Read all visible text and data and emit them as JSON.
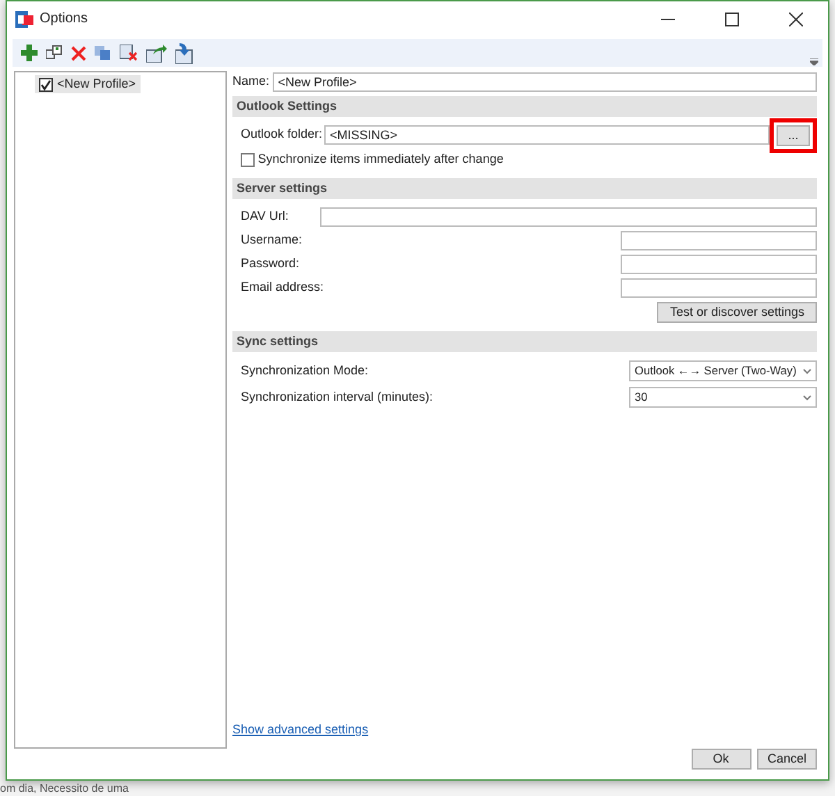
{
  "window": {
    "title": "Options"
  },
  "profiles": [
    {
      "label": "<New Profile>",
      "checked": true,
      "selected": true
    }
  ],
  "name_field": {
    "label": "Name:",
    "value": "<New Profile>"
  },
  "outlook_settings": {
    "title": "Outlook Settings",
    "folder_label": "Outlook folder:",
    "folder_value": "<MISSING>",
    "browse_button": "...",
    "browse_highlighted": true,
    "sync_immediately": {
      "label": "Synchronize items immediately after change",
      "checked": false
    }
  },
  "server_settings": {
    "title": "Server settings",
    "fields": [
      {
        "label": "DAV Url:",
        "kind": "wide"
      },
      {
        "label": "Username:",
        "kind": "short"
      },
      {
        "label": "Password:",
        "kind": "short"
      },
      {
        "label": "Email address:",
        "kind": "short"
      }
    ],
    "test_button": "Test or discover settings"
  },
  "sync_settings": {
    "title": "Sync settings",
    "rows": [
      {
        "label": "Synchronization Mode:",
        "value": "Outlook ←→ Server (Two-Way)"
      },
      {
        "label": "Synchronization interval (minutes):",
        "value": "30"
      }
    ]
  },
  "advanced_link": "Show advanced settings",
  "buttons": [
    "Ok",
    "Cancel"
  ],
  "background_text": "om dia,  Necessito de uma"
}
